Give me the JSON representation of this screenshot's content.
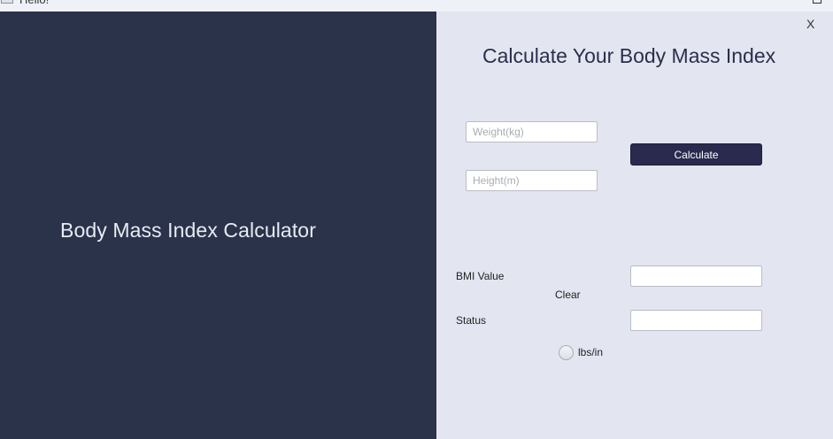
{
  "window": {
    "title": "Hello!"
  },
  "sidebar": {
    "title": "Body Mass Index Calculator"
  },
  "form": {
    "close_label": "X",
    "heading": "Calculate Your Body Mass Index",
    "weight": {
      "placeholder": "Weight(kg)",
      "value": ""
    },
    "height": {
      "placeholder": "Height(m)",
      "value": ""
    },
    "calculate_label": "Calculate",
    "bmi_label": "BMI Value",
    "bmi_value": "",
    "clear_label": "Clear",
    "status_label": "Status",
    "status_value": "",
    "unit_toggle_label": "lbs/in",
    "unit_toggle_checked": false
  },
  "colors": {
    "sidebar_bg": "#2b334b",
    "form_bg": "#e3e6f0",
    "button_bg": "#2a2a4f",
    "heading_text": "#2a2f4d"
  }
}
